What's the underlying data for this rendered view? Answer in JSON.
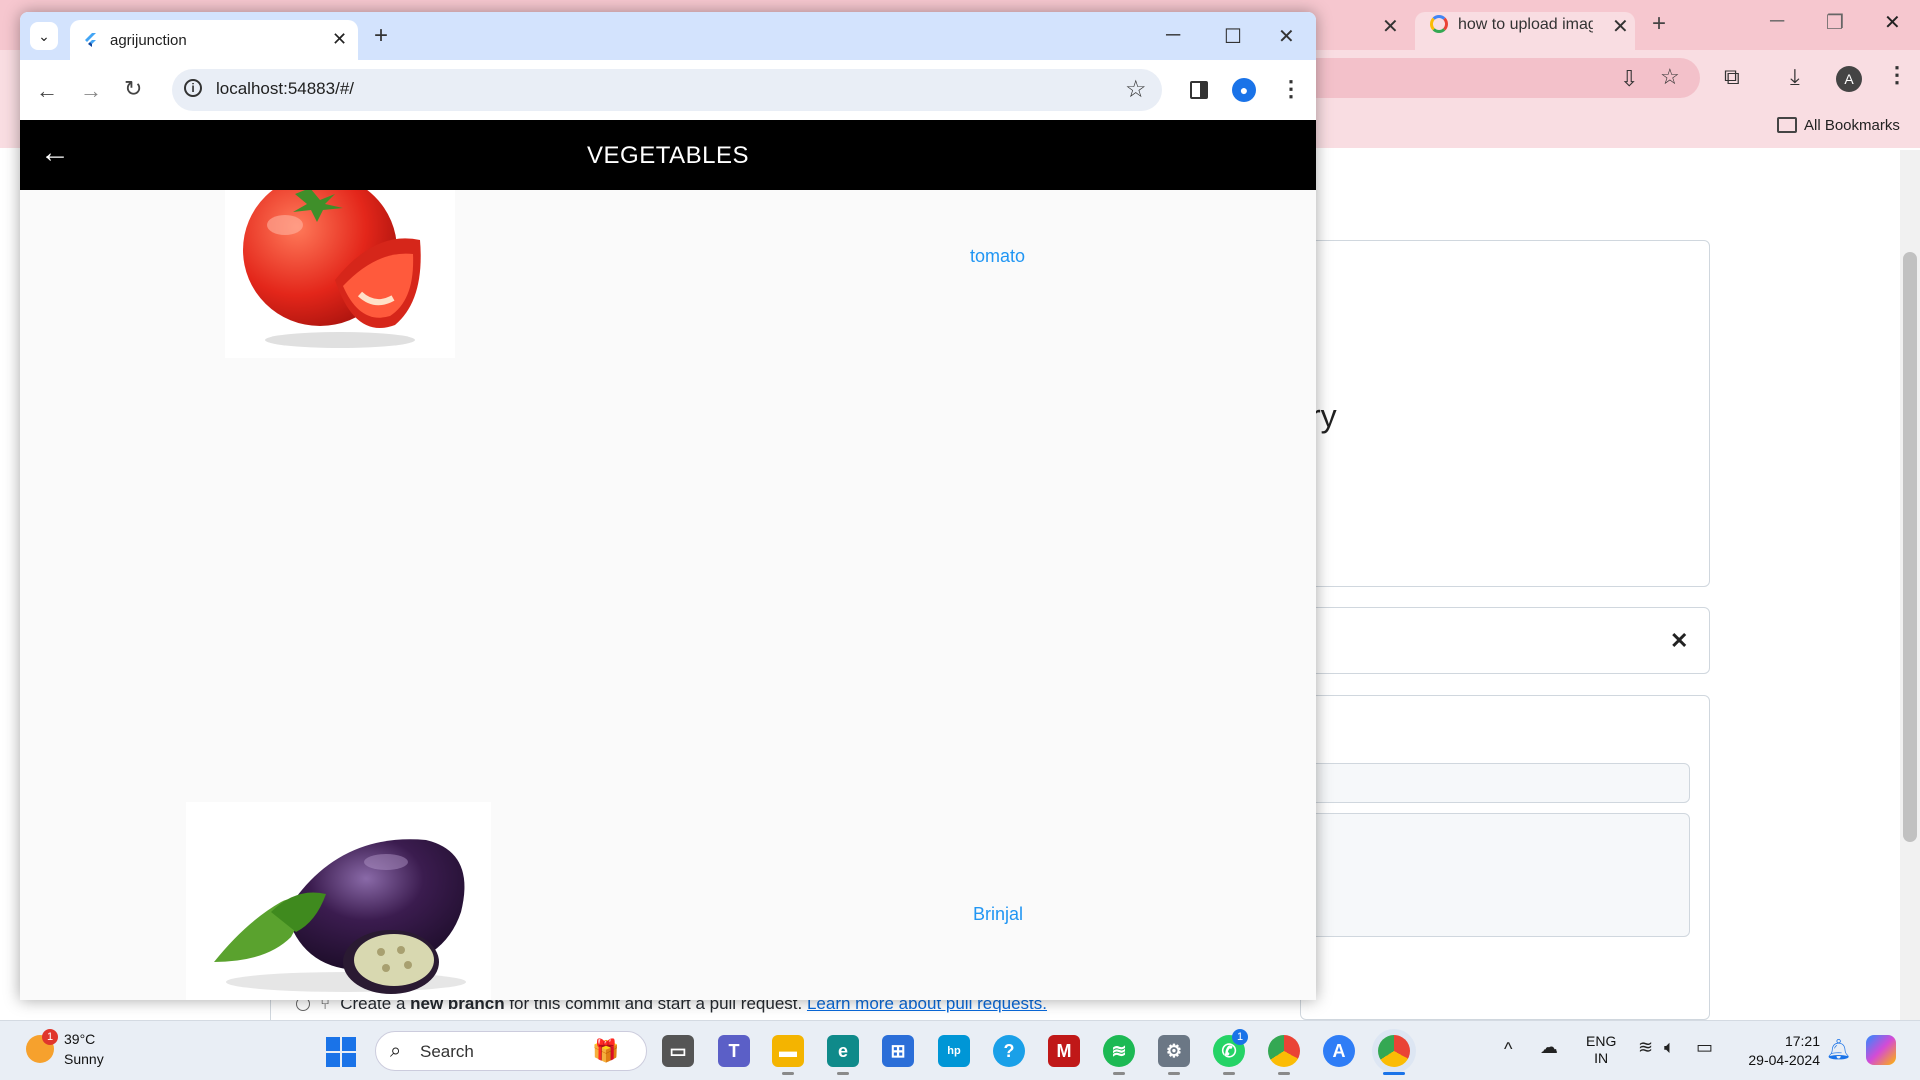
{
  "background_window": {
    "tab_title": "how to upload imag",
    "all_bookmarks": "All Bookmarks",
    "avatar_letter": "A",
    "partial_heading": "ry",
    "branch_line": {
      "prefix": "Create a ",
      "bold": "new branch",
      "middle": " for this commit and start a pull request. ",
      "link": "Learn more about pull requests."
    }
  },
  "app_window": {
    "tab_title": "agrijunction",
    "url": "localhost:54883/#/",
    "appbar_title": "VEGETABLES",
    "items": [
      {
        "label": "tomato",
        "image": "tomato"
      },
      {
        "label": "Brinjal",
        "image": "brinjal"
      }
    ]
  },
  "taskbar": {
    "weather": {
      "temp": "39°C",
      "condition": "Sunny",
      "badge": "1"
    },
    "search_placeholder": "Search",
    "language": {
      "line1": "ENG",
      "line2": "IN"
    },
    "time": "17:21",
    "date": "29-04-2024",
    "whatsapp_badge": "1"
  },
  "colors": {
    "appbar_bg": "#000000",
    "label_color": "#2196f3",
    "app_tabstrip": "#d3e3fd",
    "bg_tabstrip": "#f6c7cf"
  }
}
